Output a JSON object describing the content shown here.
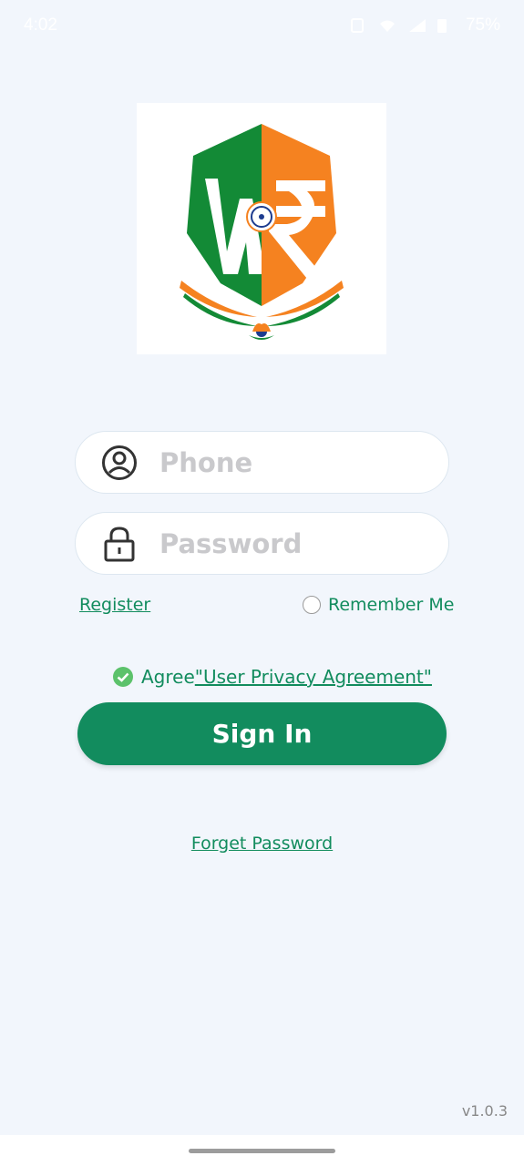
{
  "status_bar": {
    "time": "4:02",
    "battery": "75%"
  },
  "login": {
    "phone_placeholder": "Phone",
    "password_placeholder": "Password",
    "register_label": "Register",
    "remember_label": "Remember Me",
    "agree_label": "Agree",
    "policy_label": "\"User Privacy Agreement\"",
    "signin_label": "Sign In",
    "forget_label": "Forget Password"
  },
  "version": "v1.0.3",
  "colors": {
    "primary": "#128c5e",
    "background": "#f2f6fc",
    "saffron": "#f58220",
    "green": "#138a36"
  },
  "icons": [
    "person-icon",
    "lock-icon",
    "check-circle-icon",
    "radio-icon"
  ]
}
